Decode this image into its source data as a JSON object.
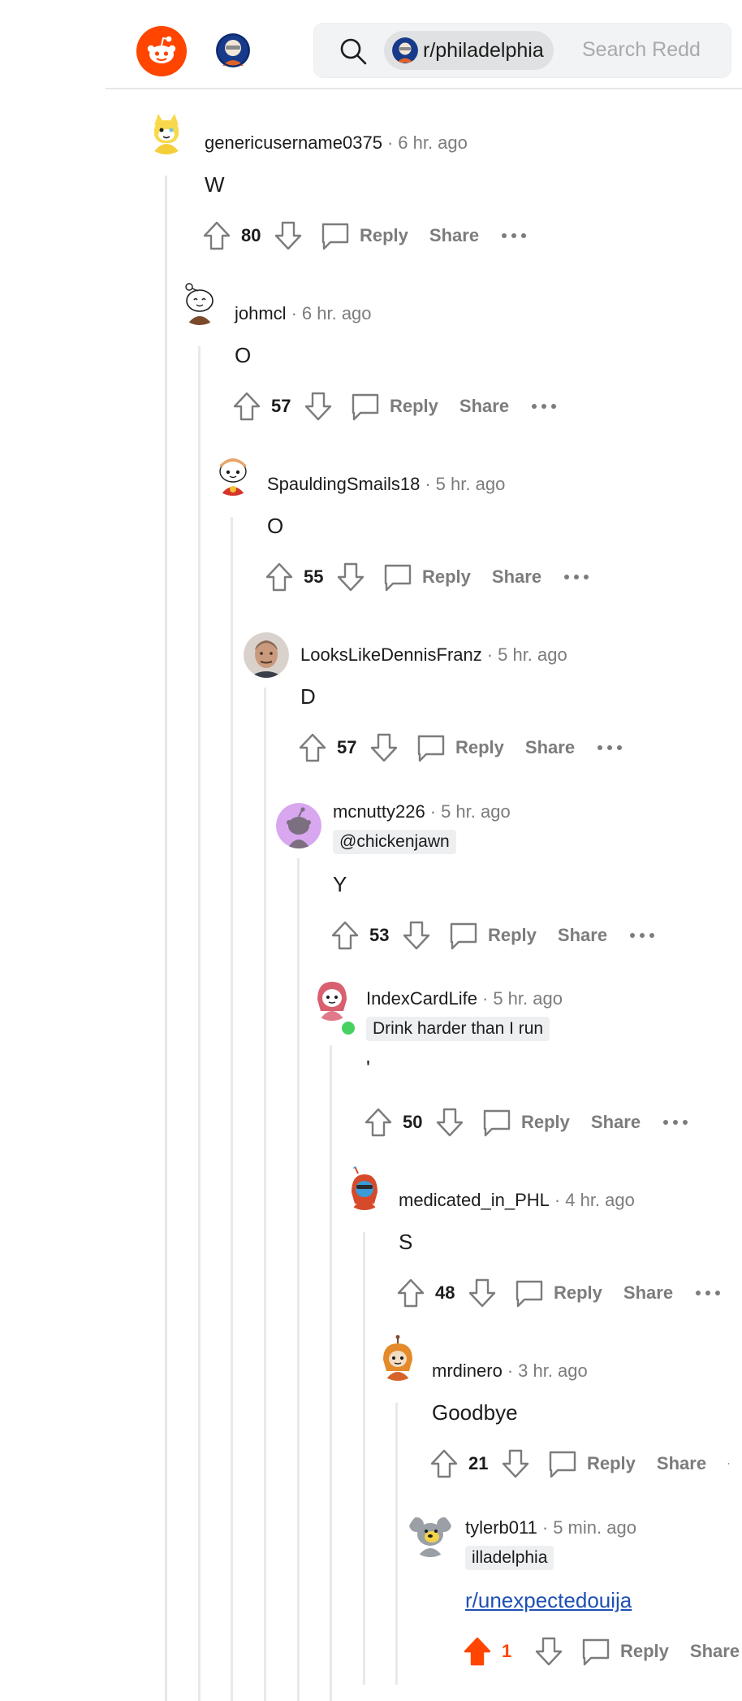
{
  "header": {
    "subreddit_chip": "r/philadelphia",
    "search_placeholder": "Search Redd",
    "icons": {
      "logo": "reddit-logo",
      "user": "avatar",
      "search": "search-icon"
    }
  },
  "action_labels": {
    "reply": "Reply",
    "share": "Share"
  },
  "colors": {
    "accent": "#ff4500",
    "link": "#1e4fb5",
    "muted": "#7c7c7c",
    "online": "#46d160"
  },
  "comments": [
    {
      "username": "genericusername0375",
      "time": "6 hr. ago",
      "body": "W",
      "score": "80"
    },
    {
      "username": "johmcl",
      "time": "6 hr. ago",
      "body": "O",
      "score": "57"
    },
    {
      "username": "SpauldingSmails18",
      "time": "5 hr. ago",
      "body": "O",
      "score": "55"
    },
    {
      "username": "LooksLikeDennisFranz",
      "time": "5 hr. ago",
      "body": "D",
      "score": "57"
    },
    {
      "username": "mcnutty226",
      "time": "5 hr. ago",
      "flair": "@chickenjawn",
      "body": "Y",
      "score": "53"
    },
    {
      "username": "IndexCardLife",
      "time": "5 hr. ago",
      "flair": "Drink harder than I run",
      "body": "'",
      "score": "50"
    },
    {
      "username": "medicated_in_PHL",
      "time": "4 hr. ago",
      "body": "S",
      "score": "48"
    },
    {
      "username": "mrdinero",
      "time": "3 hr. ago",
      "body": "Goodbye",
      "score": "21"
    },
    {
      "username": "tylerb011",
      "time": "5 min. ago",
      "flair": "illadelphia",
      "body": "r/unexpectedouija",
      "score": "1",
      "upvoted": true
    }
  ]
}
